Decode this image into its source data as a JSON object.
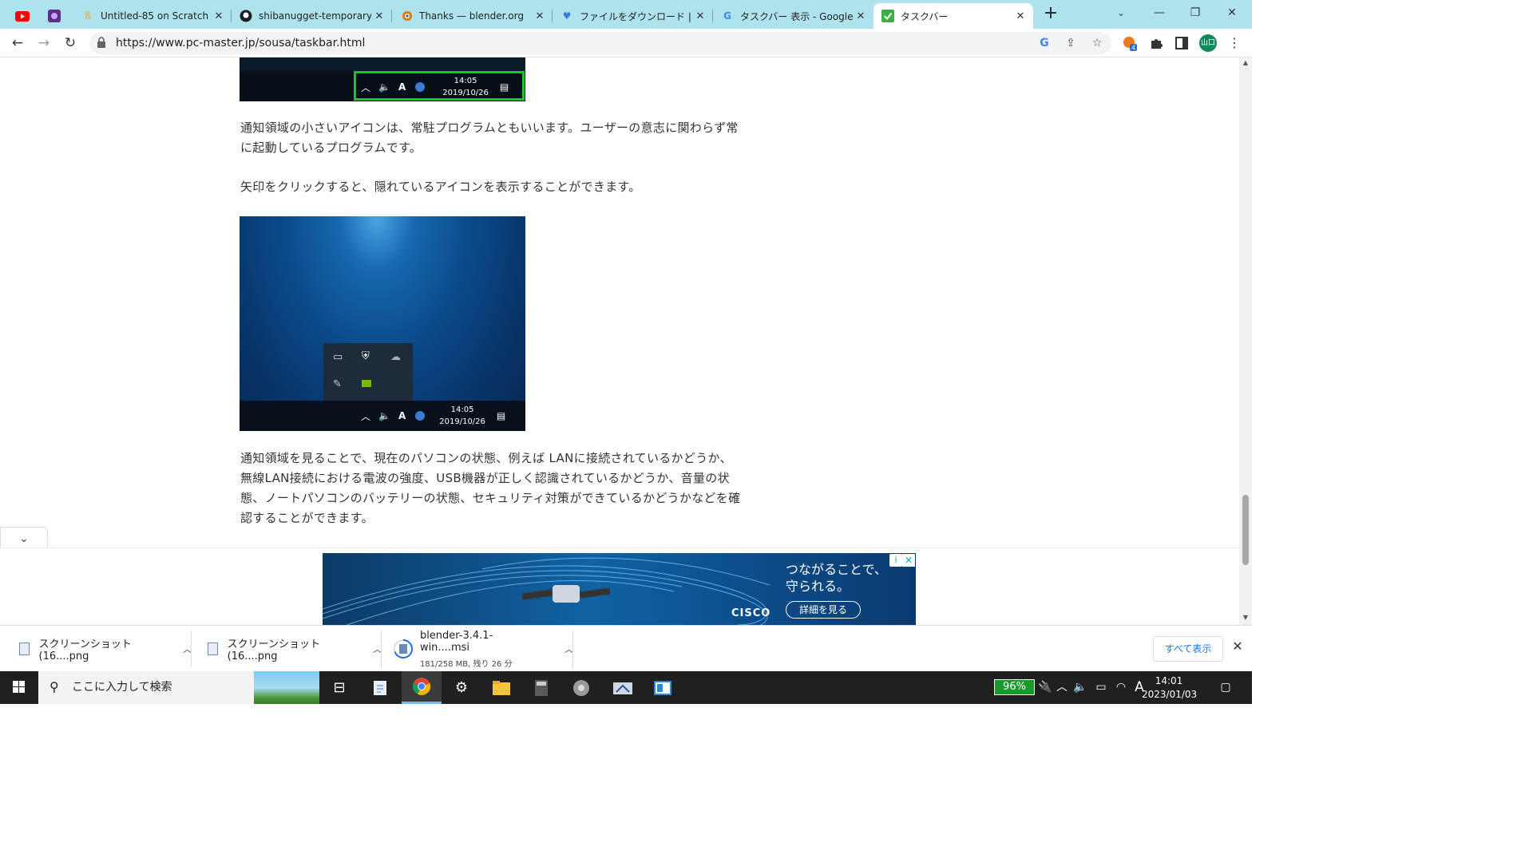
{
  "tabs": [
    {
      "title": "Untitled-85 on Scratch",
      "icon": "scratch-icon"
    },
    {
      "title": "shibanugget-temporary/",
      "icon": "github-icon"
    },
    {
      "title": "Thanks — blender.org",
      "icon": "blender-icon"
    },
    {
      "title": "ファイルをダウンロード | iLove",
      "icon": "ilovepdf-icon"
    },
    {
      "title": "タスクバー 表示 - Google",
      "icon": "google-icon"
    },
    {
      "title": "タスクバー",
      "icon": "checkmark-icon",
      "active": true
    }
  ],
  "pinned_tabs": [
    "youtube-icon",
    "app-icon"
  ],
  "toolbar": {
    "url": "https://www.pc-master.jp/sousa/taskbar.html",
    "profile_initials": "山口",
    "extension_badge": "4"
  },
  "article": {
    "top_shot": {
      "time": "14:05",
      "date": "2019/10/26"
    },
    "para1": "通知領域の小さいアイコンは、常駐プログラムともいいます。ユーザーの意志に関わらず常に起動しているプログラムです。",
    "para2": "矢印をクリックすると、隠れているアイコンを表示することができます。",
    "mid_shot": {
      "time": "14:05",
      "date": "2019/10/26"
    },
    "para3": "通知領域を見ることで、現在のパソコンの状態、例えば LANに接続されているかどうか、無線LAN接続における電波の強度、USB機器が正しく認識されているかどうか、音量の状態、ノートパソコンのバッテリーの状態、セキュリティ対策ができているかどうかなどを確認することができます。"
  },
  "ad": {
    "tagline1": "つながることで、",
    "tagline2": "守られる。",
    "cta": "詳細を見る",
    "brand": "CISCO"
  },
  "downloads": [
    {
      "name": "スクリーンショット (16....png"
    },
    {
      "name": "スクリーンショット (16....png"
    },
    {
      "name": "blender-3.4.1-win....msi",
      "status": "181/258 MB, 残り 26 分"
    }
  ],
  "download_show_all": "すべて表示",
  "taskbar": {
    "search_placeholder": "ここに入力して検索",
    "battery": "96%",
    "ime": "A",
    "time": "14:01",
    "date": "2023/01/03"
  },
  "colors": {
    "tabstrip": "#aee3ee",
    "highlight_box": "#1ac823",
    "battery": "#1a9a2a"
  }
}
